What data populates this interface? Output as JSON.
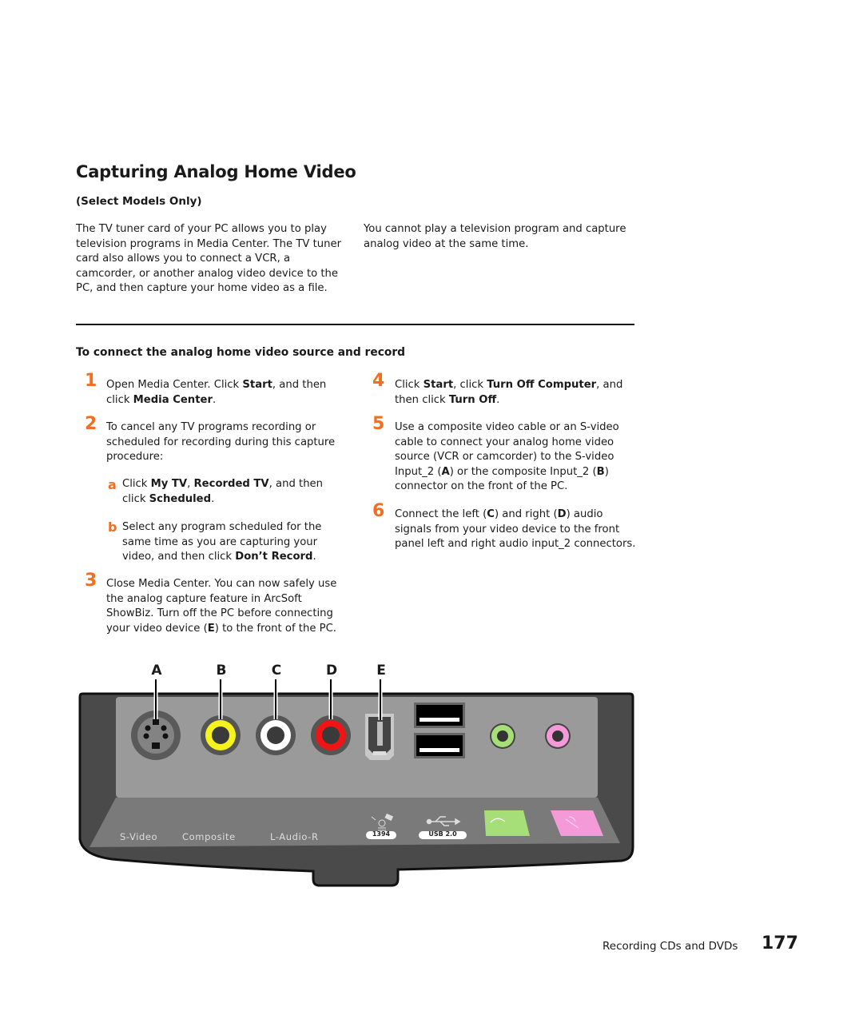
{
  "section": {
    "title": "Capturing Analog Home Video",
    "subtitle": "(Select Models Only)",
    "intro_left": "The TV tuner card of your PC allows you to play television programs in Media Center. The TV tuner card also allows you to connect a VCR, a camcorder, or another analog video device to the PC, and then capture your home video as a file.",
    "intro_right": "You cannot play a television program and capture analog video at the same time."
  },
  "procedure": {
    "heading": "To connect the analog home video source and record",
    "steps": [
      {
        "number": "1",
        "parts": [
          "Open Media Center. Click ",
          "Start",
          ", and then click ",
          "Media Center",
          "."
        ]
      },
      {
        "number": "2",
        "text": "To cancel any TV programs recording or scheduled for recording during this capture procedure:",
        "substeps": [
          {
            "letter": "a",
            "parts": [
              "Click ",
              "My TV",
              ", ",
              "Recorded TV",
              ", and then click ",
              "Scheduled",
              "."
            ]
          },
          {
            "letter": "b",
            "parts": [
              "Select any program scheduled for the same time as you are capturing your video, and then click ",
              "Don’t Record",
              "."
            ]
          }
        ]
      },
      {
        "number": "3",
        "parts": [
          "Close Media Center. You can now safely use the analog capture feature in ArcSoft ShowBiz. Turn off the PC before connecting your video device (",
          "E",
          ") to the front of the PC."
        ]
      },
      {
        "number": "4",
        "parts": [
          "Click ",
          "Start",
          ", click ",
          "Turn Off Computer",
          ", and then click ",
          "Turn Off",
          "."
        ]
      },
      {
        "number": "5",
        "parts": [
          "Use a composite video cable or an S-video cable to connect your analog home video source (VCR or camcorder) to the S-video Input_2 (",
          "A",
          ") or the composite Input_2 (",
          "B",
          ") connector on the front of the PC."
        ]
      },
      {
        "number": "6",
        "parts": [
          "Connect the left (",
          "C",
          ") and right (",
          "D",
          ") audio signals from your video device to the front panel left and right audio input_2 connectors."
        ]
      }
    ]
  },
  "figure": {
    "callouts": [
      "A",
      "B",
      "C",
      "D",
      "E"
    ],
    "panel_labels": [
      "S-Video",
      "Composite",
      "L-Audio-R",
      "1394",
      "USB 2.0"
    ],
    "colors": {
      "composite_video": "#f5f21e",
      "audio_left": "#ffffff",
      "audio_right": "#f01414",
      "headphone": "#a6de78",
      "microphone": "#f59ad9",
      "panel": "#9a9a9a",
      "bezel": "#4a4a4a"
    }
  },
  "footer": {
    "chapter": "Recording CDs and DVDs",
    "page_number": "177"
  },
  "accent_color": "#f26f21"
}
